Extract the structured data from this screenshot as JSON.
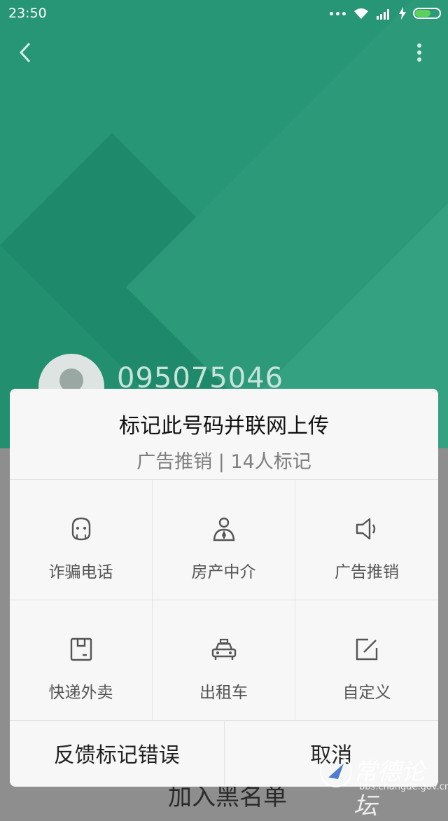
{
  "status_bar": {
    "time": "23:50"
  },
  "contact": {
    "number": "095075046"
  },
  "dialog": {
    "title": "标记此号码并联网上传",
    "subtitle": "广告推销 | 14人标记",
    "options": [
      {
        "label": "诈骗电话",
        "icon": "fraud-mask-icon"
      },
      {
        "label": "房产中介",
        "icon": "agent-person-icon"
      },
      {
        "label": "广告推销",
        "icon": "megaphone-icon"
      },
      {
        "label": "快递外卖",
        "icon": "package-icon"
      },
      {
        "label": "出租车",
        "icon": "taxi-icon"
      },
      {
        "label": "自定义",
        "icon": "edit-icon"
      }
    ],
    "feedback_label": "反馈标记错误",
    "cancel_label": "取消"
  },
  "background_page": {
    "partial_text": "加入黑名单"
  },
  "watermark": {
    "text": "常德论坛",
    "url": "bbs.changde.gov.cn"
  },
  "colors": {
    "header_green": "#279676",
    "battery_green": "#5bd25a"
  }
}
